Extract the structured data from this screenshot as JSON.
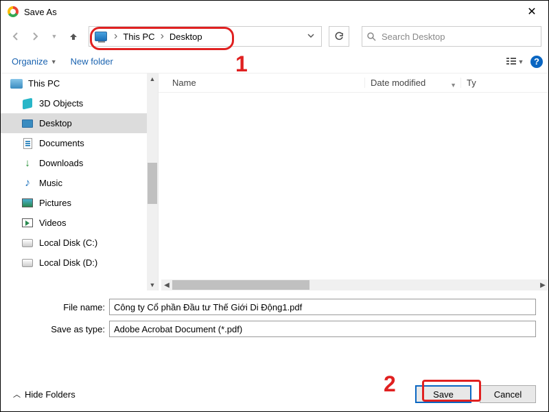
{
  "window": {
    "title": "Save As"
  },
  "breadcrumb": {
    "root": "This PC",
    "child": "Desktop"
  },
  "search": {
    "placeholder": "Search Desktop"
  },
  "toolbar": {
    "organize": "Organize",
    "new_folder": "New folder"
  },
  "columns": {
    "name": "Name",
    "date": "Date modified",
    "type": "Ty"
  },
  "tree": {
    "root": "This PC",
    "items": [
      "3D Objects",
      "Desktop",
      "Documents",
      "Downloads",
      "Music",
      "Pictures",
      "Videos",
      "Local Disk (C:)",
      "Local Disk (D:)"
    ]
  },
  "form": {
    "filename_label": "File name:",
    "filename_value": "Công ty Cổ phần Đầu tư Thế Giới Di Động1.pdf",
    "type_label": "Save as type:",
    "type_value": "Adobe Acrobat Document (*.pdf)"
  },
  "footer": {
    "hide_folders": "Hide Folders",
    "save": "Save",
    "cancel": "Cancel"
  },
  "annotations": {
    "one": "1",
    "two": "2"
  }
}
